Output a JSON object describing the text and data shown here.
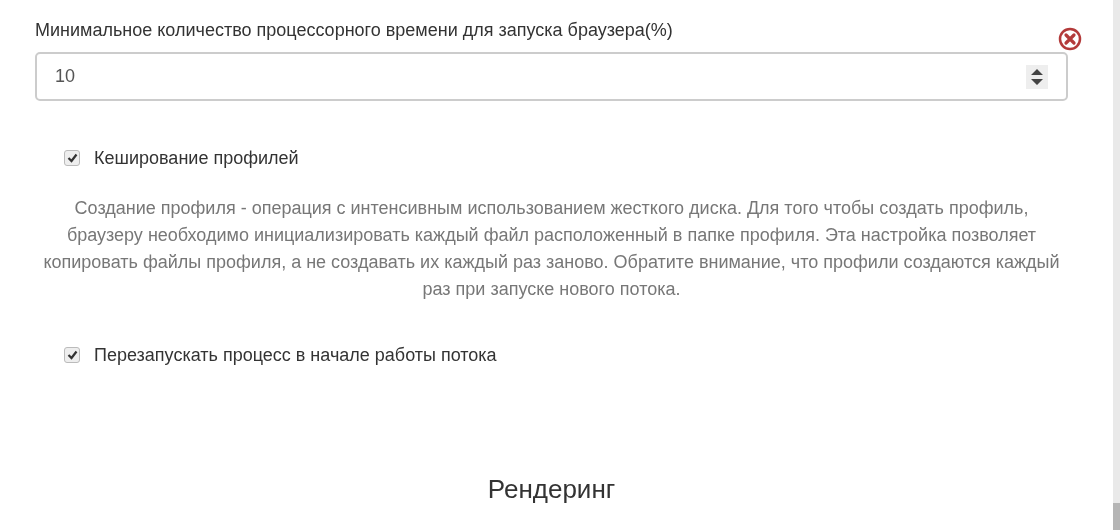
{
  "cpu_field": {
    "label": "Минимальное количество процессорного времени для запуска браузера(%)",
    "value": "10"
  },
  "options": [
    {
      "label": "Кеширование профилей",
      "checked": true,
      "description": "Создание профиля - операция с интенсивным использованием жесткого диска. Для того чтобы создать профиль, браузеру необходимо инициализировать каждый файл расположенный в папке профиля. Эта настройка позволяет копировать файлы профиля, а не создавать их каждый раз заново. Обратите внимание, что профили создаются каждый раз при запуске нового потока."
    },
    {
      "label": "Перезапускать процесс в начале работы потока",
      "checked": true
    }
  ],
  "section_heading": "Рендеринг"
}
